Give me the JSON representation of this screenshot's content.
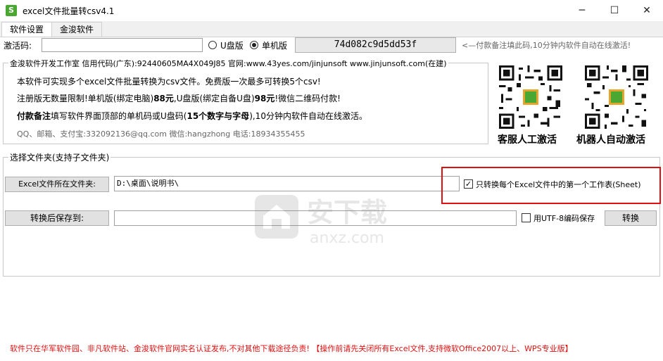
{
  "window": {
    "title": "excel文件批量转csv4.1",
    "icon": "excel-app-icon",
    "minimize": "─",
    "maximize": "☐",
    "close": "✕"
  },
  "tabs": [
    {
      "label": "软件设置"
    },
    {
      "label": "金浚软件"
    }
  ],
  "activation": {
    "label": "激活码:",
    "value": "",
    "radio_usb": "U盘版",
    "radio_pc": "单机版",
    "selected": "单机版",
    "machine_code": "74d082c9d5dd53f",
    "hint": "<—付款备注填此码,10分钟内软件自动在线激活!"
  },
  "info": {
    "header": "金浚软件开发工作室 信用代码(广东):92440605MA4X049J85 官网:www.43yes.com/jinjunsoft  www.jinjunsoft.com(在建)",
    "line1": "本软件可实现多个excel文件批量转换为csv文件。免费版一次最多可转换5个csv!",
    "line2_a": "注册版无数量限制!单机版(绑定电脑)",
    "line2_b": "88元",
    "line2_c": ",U盘版(绑定自备U盘)",
    "line2_d": "98元",
    "line2_e": "!微信二维码付款!",
    "line3_a": "付款备注",
    "line3_b": "填写软件界面顶部的单机码或U盘码(",
    "line3_c": "15个数字与字母",
    "line3_d": "),10分钟内软件自动在线激活。",
    "contact": "QQ、邮箱、支付宝:332092136@qq.com  微信:hangzhong  电话:18934355455",
    "qr1_label": "客服人工激活",
    "qr2_label": "机器人自动激活"
  },
  "folder": {
    "group_title": "选择文件夹(支持子文件夹)",
    "source_button": "Excel文件所在文件夹:",
    "source_value": "D:\\桌面\\说明书\\",
    "first_sheet_label": "只转换每个Excel文件中的第一个工作表(Sheet)",
    "first_sheet_checked": true,
    "save_button": "转换后保存到:",
    "save_value": "",
    "utf8_label": "用UTF-8编码保存",
    "utf8_checked": false,
    "convert_button": "转换"
  },
  "footer": "软件只在华军软件园、非凡软件站、金浚软件官网实名认证发布,不对其他下载途径负责! 【操作前请先关闭所有Excel文件,支持微软Office2007以上、WPS专业版】",
  "watermark": {
    "text_cn": "安下载",
    "text_en": "anxz.com"
  },
  "colors": {
    "highlight": "#e01010",
    "app_icon": "#4aa832"
  }
}
